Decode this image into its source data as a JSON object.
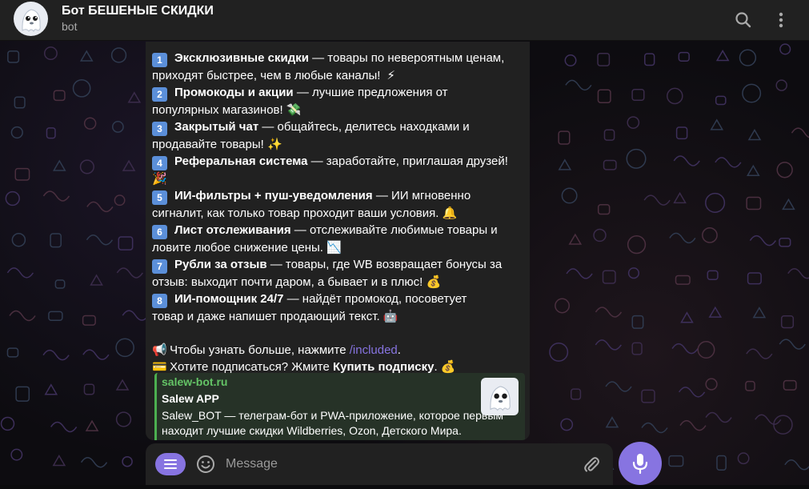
{
  "header": {
    "title": "Бот БЕШЕНЫЕ СКИДКИ",
    "subtitle": "bot",
    "avatar_icon": "ghost-mascot-icon",
    "search_icon": "search-icon",
    "more_icon": "more-vertical-icon"
  },
  "message": {
    "features": [
      {
        "num": "1",
        "title": "Эксклюзивные скидки",
        "rest1": " — товары по невероятным ценам,",
        "line2": "приходят быстрее, чем в любые каналы!",
        "emoji": "⚡"
      },
      {
        "num": "2",
        "title": "Промокоды и акции",
        "rest1": " — лучшие предложения от",
        "line2": "популярных магазинов!",
        "emoji": "💸"
      },
      {
        "num": "3",
        "title": "Закрытый чат",
        "rest1": " — общайтесь, делитесь находками и",
        "line2": "продавайте товары!",
        "emoji": "✨"
      },
      {
        "num": "4",
        "title": "Реферальная система",
        "rest1": " — заработайте, приглашая друзей!",
        "line2": "",
        "emoji": "🎉"
      },
      {
        "num": "5",
        "title": "ИИ-фильтры + пуш-уведомления",
        "rest1": " — ИИ мгновенно",
        "line2": "сигналит, как только товар проходит ваши условия.",
        "emoji": "🔔"
      },
      {
        "num": "6",
        "title": "Лист отслеживания",
        "rest1": " — отслеживайте любимые товары и",
        "line2": "ловите любое снижение цены.",
        "emoji": "📉"
      },
      {
        "num": "7",
        "title": "Рубли за отзыв",
        "rest1": " — товары, где WB возвращает бонусы за",
        "line2": "отзыв: выходит почти даром, а бывает и в плюс!",
        "emoji": "💰"
      },
      {
        "num": "8",
        "title": "ИИ-помощник 24/7",
        "rest1": " — найдёт промокод, посоветует",
        "line2": "товар и даже напишет продающий текст.",
        "emoji": "🤖"
      }
    ],
    "cta1": {
      "emoji": "📢",
      "text": "Чтобы узнать больше, нажмите ",
      "command": "/included",
      "after": "."
    },
    "cta2": {
      "emoji": "💳",
      "text": "Хотите подписаться? Жмите ",
      "bold": "Купить подписку",
      "after": ".",
      "trail_emoji": "💰"
    }
  },
  "link_preview": {
    "site": "salew-bot.ru",
    "title": "Salew APP",
    "description": "Salew_BOT — телеграм-бот и PWA-приложение, которое первым находит лучшие скидки Wildberries, Ozon, Детского Мира. Мгновенные уведомления, AI-фильтры",
    "thumb_icon": "ghost-mascot-icon"
  },
  "composer": {
    "placeholder": "Message",
    "menu_icon": "menu-icon",
    "emoji_icon": "smile-icon",
    "attach_icon": "paperclip-icon",
    "mic_icon": "microphone-icon"
  },
  "colors": {
    "accent": "#8774e1",
    "header_bg": "#212121",
    "bubble_bg": "#212121",
    "link_green": "#4caf50",
    "keycap_blue": "#5b8fd9"
  }
}
